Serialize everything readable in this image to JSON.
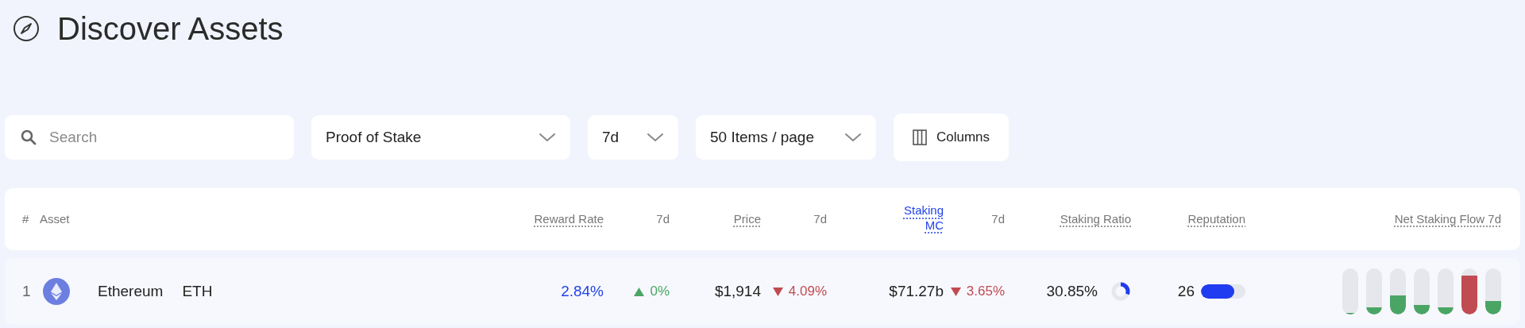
{
  "page": {
    "title": "Discover Assets"
  },
  "filters": {
    "search": {
      "placeholder": "Search"
    },
    "dropdowns": [
      {
        "value": "Proof of Stake"
      },
      {
        "value": "7d"
      },
      {
        "value": "50 Items / page"
      }
    ],
    "columns_button": "Columns"
  },
  "table": {
    "columns": [
      {
        "label": "#",
        "kind": "plain",
        "selected": false
      },
      {
        "label": "Asset",
        "kind": "plain",
        "selected": false
      },
      {
        "label": "Reward Rate",
        "kind": "sortable",
        "selected": false
      },
      {
        "label": "7d",
        "kind": "plain",
        "selected": false
      },
      {
        "label": "Price",
        "kind": "sortable",
        "selected": false
      },
      {
        "label": "7d",
        "kind": "plain",
        "selected": false
      },
      {
        "label": "Staking MC",
        "kind": "sortable",
        "selected": true
      },
      {
        "label": "7d",
        "kind": "plain",
        "selected": false
      },
      {
        "label": "Staking Ratio",
        "kind": "sortable",
        "selected": false
      },
      {
        "label": "Reputation",
        "kind": "sortable",
        "selected": false
      },
      {
        "label": "Net Staking Flow 7d",
        "kind": "sortable",
        "selected": false
      }
    ],
    "rows": [
      {
        "rank": "1",
        "name": "Ethereum",
        "symbol": "ETH",
        "reward_rate": "2.84%",
        "reward_change": {
          "text": "0%",
          "rising": true
        },
        "price": "$1,914",
        "price_change": {
          "text": "4.09%",
          "rising": false
        },
        "staking_mc": "$71.27b",
        "staking_mc_change": {
          "text": "3.65%",
          "rising": false
        },
        "staking_ratio": "30.85%",
        "reputation": {
          "text": "26",
          "level": 0.75
        },
        "net_flow": [
          {
            "level": 0.04,
            "color": "#4aa564"
          },
          {
            "level": 0.15,
            "color": "#4aa564"
          },
          {
            "level": 0.42,
            "color": "#4aa564"
          },
          {
            "level": 0.2,
            "color": "#4aa564"
          },
          {
            "level": 0.16,
            "color": "#4aa564"
          },
          {
            "level": 0.85,
            "color": "#c14b52"
          },
          {
            "level": 0.3,
            "color": "#4aa564"
          }
        ]
      }
    ]
  }
}
